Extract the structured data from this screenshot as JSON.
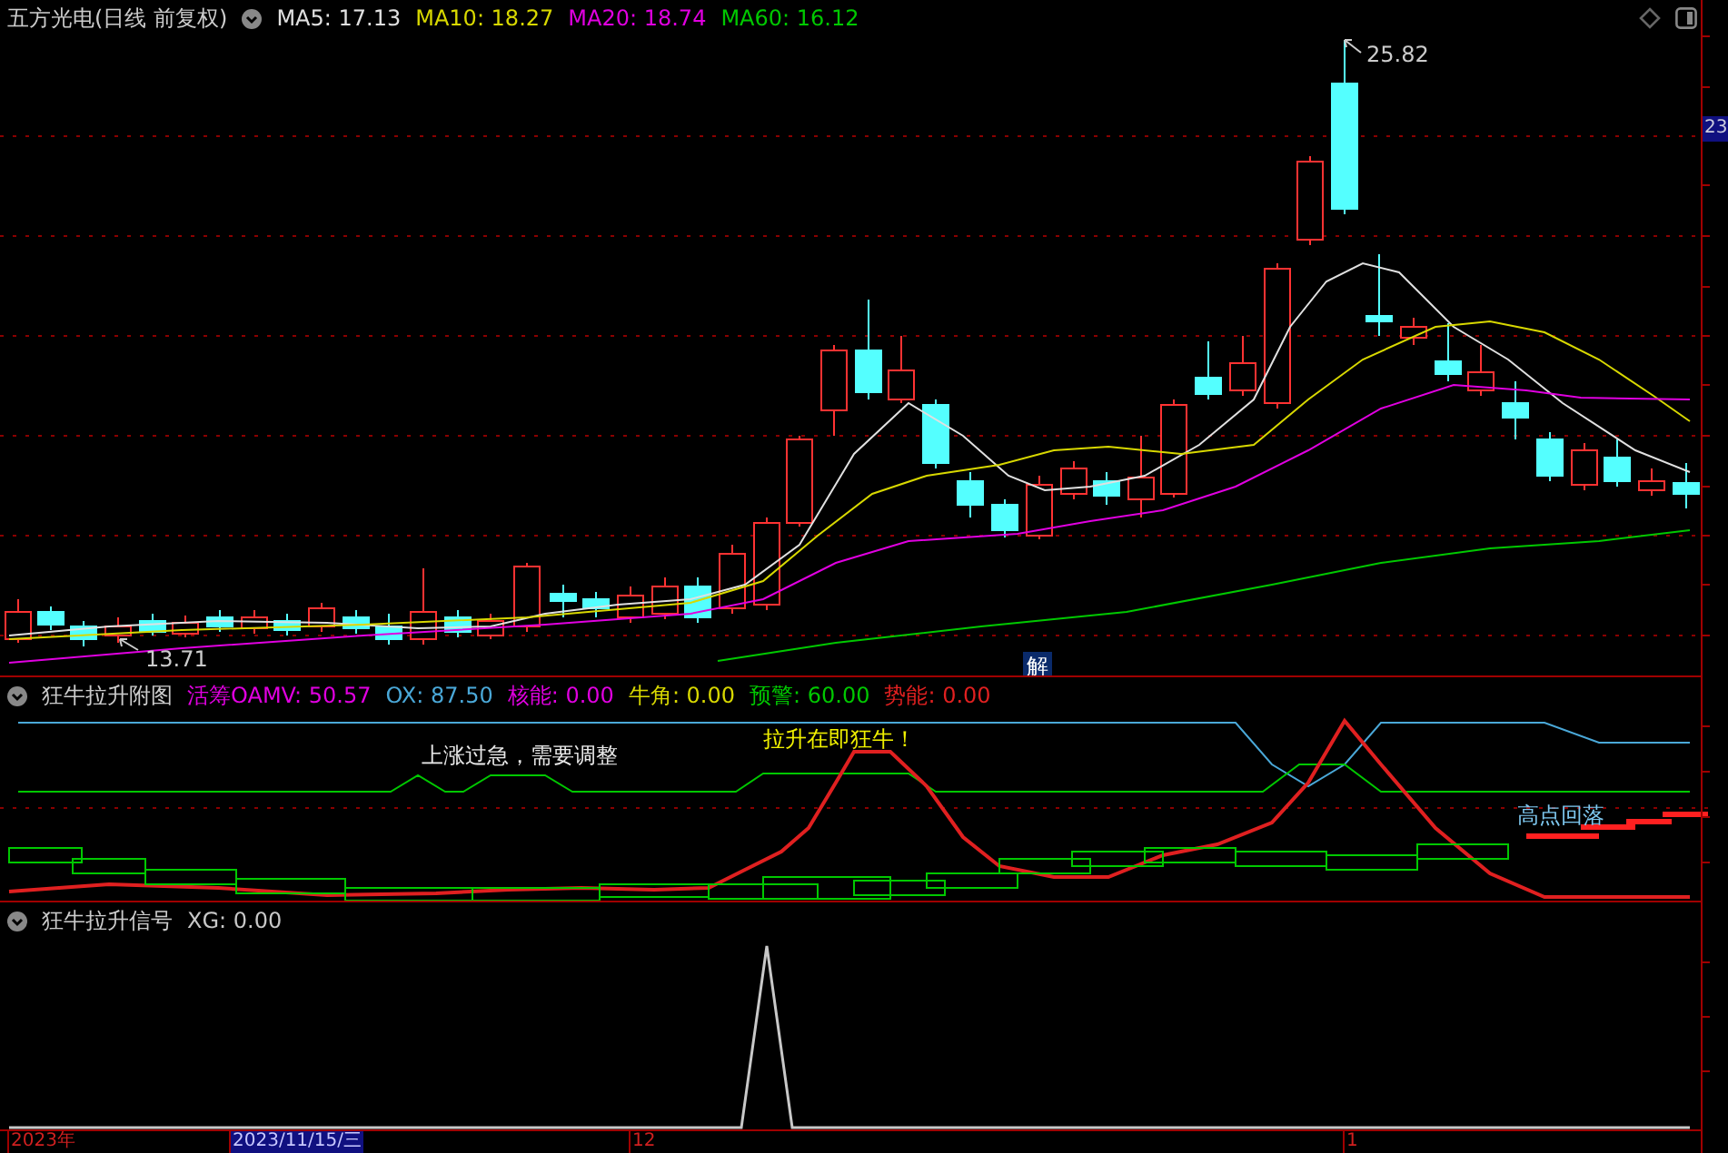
{
  "instrument": {
    "title": "五方光电(日线 前复权)"
  },
  "main_indicators": [
    {
      "label": "MA5: 17.13",
      "color": "#e0e0e0"
    },
    {
      "label": "MA10: 18.27",
      "color": "#d8d800"
    },
    {
      "label": "MA20: 18.74",
      "color": "#e000e0"
    },
    {
      "label": "MA60: 16.12",
      "color": "#00c800"
    }
  ],
  "max_label": "25.82",
  "min_label": "13.71",
  "price_axis_label": "23",
  "marker_label": "解",
  "sub_panel_1": {
    "title": "狂牛拉升附图",
    "indicators": [
      {
        "label": "活筹OAMV: 50.57",
        "color": "#e000e0"
      },
      {
        "label": "OX: 87.50",
        "color": "#4aa8d8"
      },
      {
        "label": "核能: 0.00",
        "color": "#e000e0"
      },
      {
        "label": "牛角: 0.00",
        "color": "#d8d800"
      },
      {
        "label": "预警: 60.00",
        "color": "#00c800"
      },
      {
        "label": "势能: 0.00",
        "color": "#e02020"
      }
    ],
    "annotations": [
      "上涨过急，需要调整",
      "拉升在即狂牛！",
      "高点回落"
    ]
  },
  "sub_panel_2": {
    "title": "狂牛拉升信号",
    "indicators": [
      {
        "label": "XG: 0.00",
        "color": "#c8c8c8"
      }
    ]
  },
  "time_axis": [
    {
      "label": "2023年",
      "selected": false
    },
    {
      "label": "2023/11/15/三",
      "selected": true
    },
    {
      "label": "12",
      "selected": false
    },
    {
      "label": "1",
      "selected": false
    }
  ]
}
